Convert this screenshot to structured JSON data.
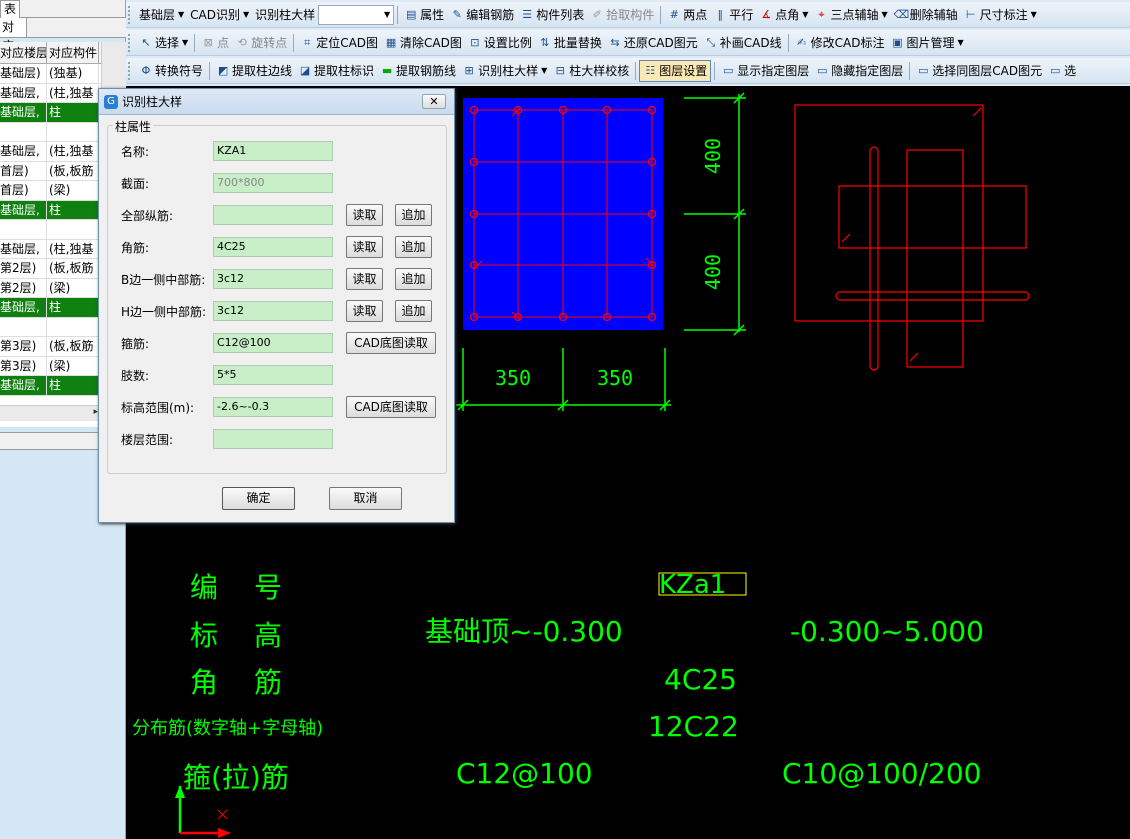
{
  "left_panel": {
    "tab": "表",
    "subtab": "对应",
    "headers": [
      "对应楼层",
      "对应构件"
    ],
    "rows": [
      {
        "floor": "基础层)",
        "comp": "(独基)",
        "selected": false
      },
      {
        "floor": "基础层,",
        "comp": "(柱,独基",
        "selected": false
      },
      {
        "floor": "基础层,",
        "comp": "柱",
        "selected": true
      },
      {
        "floor": "",
        "comp": "",
        "selected": false
      },
      {
        "floor": "基础层,",
        "comp": "(柱,独基",
        "selected": false
      },
      {
        "floor": "首层)",
        "comp": "(板,板筋",
        "selected": false
      },
      {
        "floor": "首层)",
        "comp": "(梁)",
        "selected": false
      },
      {
        "floor": "基础层,",
        "comp": "柱",
        "selected": true
      },
      {
        "floor": "",
        "comp": "",
        "selected": false
      },
      {
        "floor": "基础层,",
        "comp": "(柱,独基",
        "selected": false
      },
      {
        "floor": "第2层)",
        "comp": "(板,板筋",
        "selected": false
      },
      {
        "floor": "第2层)",
        "comp": "(梁)",
        "selected": false
      },
      {
        "floor": "基础层,",
        "comp": "柱",
        "selected": true
      },
      {
        "floor": "",
        "comp": "",
        "selected": false
      },
      {
        "floor": "第3层)",
        "comp": "(板,板筋",
        "selected": false
      },
      {
        "floor": "第3层)",
        "comp": "(梁)",
        "selected": false
      },
      {
        "floor": "基础层,",
        "comp": "柱",
        "selected": true
      }
    ]
  },
  "toolbar": {
    "row1": {
      "floor_select": "基础层",
      "cad_identify": "CAD识别",
      "identify_detail": "识别柱大样",
      "combo_value": "",
      "properties": "属性",
      "edit_rebar": "编辑钢筋",
      "component_list": "构件列表",
      "pick_component": "拾取构件",
      "two_points": "两点",
      "parallel": "平行",
      "point_angle": "点角",
      "three_point_axis": "三点辅轴",
      "delete_axis": "删除辅轴",
      "dimension": "尺寸标注"
    },
    "row2": {
      "select": "选择",
      "point": "点",
      "rotate_point": "旋转点",
      "locate_cad": "定位CAD图",
      "clear_cad": "清除CAD图",
      "set_scale": "设置比例",
      "batch_replace": "批量替换",
      "restore_cad": "还原CAD图元",
      "patch_cad_line": "补画CAD线",
      "modify_cad_label": "修改CAD标注",
      "image_manage": "图片管理"
    },
    "row3": {
      "convert_symbol": "转换符号",
      "extract_edge": "提取柱边线",
      "extract_label": "提取柱标识",
      "extract_rebar_line": "提取钢筋线",
      "identify_detail": "识别柱大样",
      "check_detail": "柱大样校核",
      "layer_settings": "图层设置",
      "show_layer": "显示指定图层",
      "hide_layer": "隐藏指定图层",
      "select_same_layer": "选择同图层CAD图元",
      "select_more": "选"
    }
  },
  "dialog": {
    "title": "识别柱大样",
    "group_title": "柱属性",
    "fields": {
      "name": {
        "label": "名称:",
        "value": "KZA1"
      },
      "section": {
        "label": "截面:",
        "value": "700*800"
      },
      "all_rebar": {
        "label": "全部纵筋:",
        "value": ""
      },
      "corner_rebar": {
        "label": "角筋:",
        "value": "4C25"
      },
      "b_side": {
        "label": "B边一侧中部筋:",
        "value": "3c12"
      },
      "h_side": {
        "label": "H边一侧中部筋:",
        "value": "3c12"
      },
      "stirrup": {
        "label": "箍筋:",
        "value": "C12@100"
      },
      "legs": {
        "label": "肢数:",
        "value": "5*5"
      },
      "elevation": {
        "label": "标高范围(m):",
        "value": "-2.6~-0.3"
      },
      "floor_range": {
        "label": "楼层范围:",
        "value": ""
      }
    },
    "read_label": "读取",
    "add_label": "追加",
    "cad_read_label": "CAD底图读取",
    "ok_label": "确定",
    "cancel_label": "取消"
  },
  "cad": {
    "dim_top": "400",
    "dim_bottom": "400",
    "dim_left": "350",
    "dim_right": "350",
    "table": {
      "label_number_1": "编",
      "label_number_2": "号",
      "label_elev_1": "标",
      "label_elev_2": "高",
      "label_corner_1": "角",
      "label_corner_2": "筋",
      "label_dist": "分布筋(数字轴+字母轴)",
      "label_stirrup": "箍(拉)筋",
      "value_number": "KZa1",
      "elev_1": "基础顶~-0.300",
      "elev_2": "-0.300~5.000",
      "corner": "4C25",
      "dist": "12C22",
      "stirrup_1": "C12@100",
      "stirrup_2": "C10@100/200"
    },
    "colors": {
      "green": "#00ff00",
      "red": "#ff0000",
      "blue": "#0000ff",
      "yellow": "#ffff00"
    }
  }
}
